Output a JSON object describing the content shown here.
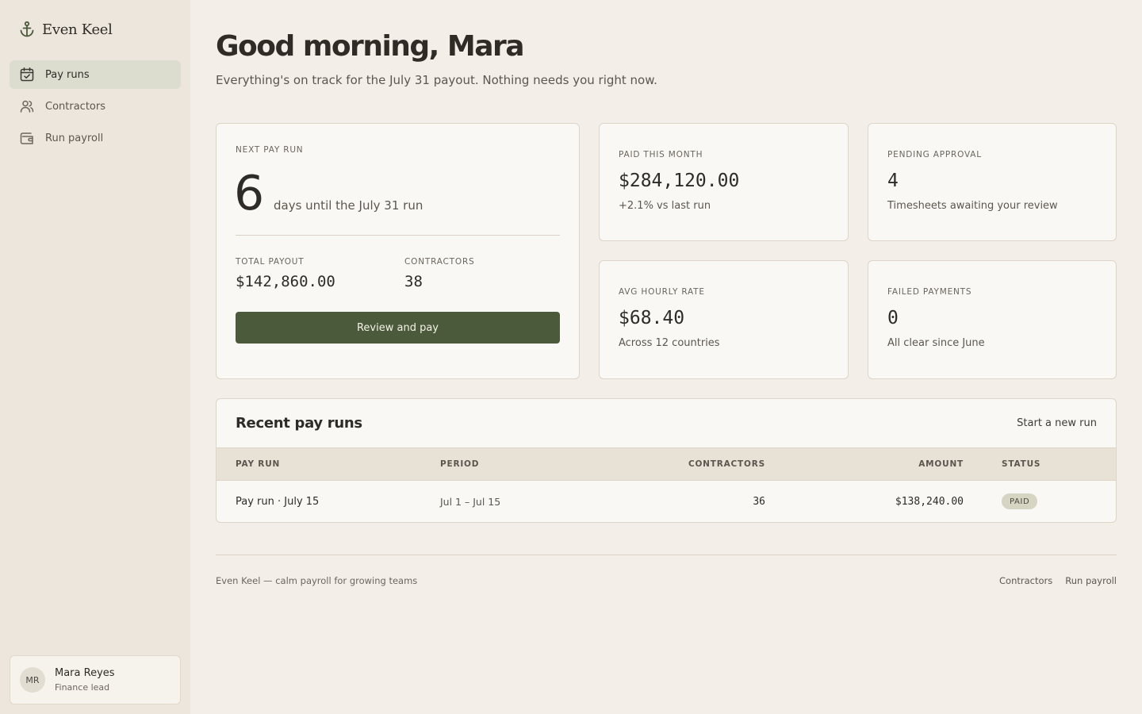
{
  "brand": {
    "name": "Even Keel",
    "icon": "anchor-icon"
  },
  "nav": {
    "items": [
      {
        "label": "Pay runs",
        "icon": "calendar-check-icon",
        "active": true
      },
      {
        "label": "Contractors",
        "icon": "users-icon",
        "active": false
      },
      {
        "label": "Run payroll",
        "icon": "wallet-icon",
        "active": false
      }
    ]
  },
  "user": {
    "initials": "MR",
    "name": "Mara Reyes",
    "role": "Finance lead"
  },
  "header": {
    "greeting": "Good morning, Mara",
    "subtitle": "Everything's on track for the July 31 payout. Nothing needs you right now."
  },
  "next_run": {
    "label": "NEXT PAY RUN",
    "days": "6",
    "days_text": "days until the July 31 run",
    "total_label": "TOTAL PAYOUT",
    "total_value": "$142,860.00",
    "contractors_label": "CONTRACTORS",
    "contractors_value": "38",
    "button_label": "Review and pay"
  },
  "kpis": {
    "paid": {
      "label": "PAID THIS MONTH",
      "value": "$284,120.00",
      "sub": "+2.1% vs last run"
    },
    "pending": {
      "label": "PENDING APPROVAL",
      "value": "4",
      "sub": "Timesheets awaiting your review"
    },
    "rate": {
      "label": "AVG HOURLY RATE",
      "value": "$68.40",
      "sub": "Across 12 countries"
    },
    "failed": {
      "label": "FAILED PAYMENTS",
      "value": "0",
      "sub": "All clear since June"
    }
  },
  "recent": {
    "title": "Recent pay runs",
    "action": "Start a new run",
    "columns": {
      "run": "PAY RUN",
      "period": "PERIOD",
      "contractors": "CONTRACTORS",
      "amount": "AMOUNT",
      "status": "STATUS"
    },
    "rows": [
      {
        "run": "Pay run · July 15",
        "period": "Jul 1 – Jul 15",
        "contractors": "36",
        "amount": "$138,240.00",
        "status": "PAID"
      }
    ]
  },
  "footer": {
    "tagline": "Even Keel — calm payroll for growing teams",
    "links": [
      "Contractors",
      "Run payroll"
    ]
  },
  "colors": {
    "accent": "#4b5a3a",
    "background": "#f3efe8",
    "sidebar": "#ece6dc",
    "card": "#faf8f4"
  }
}
